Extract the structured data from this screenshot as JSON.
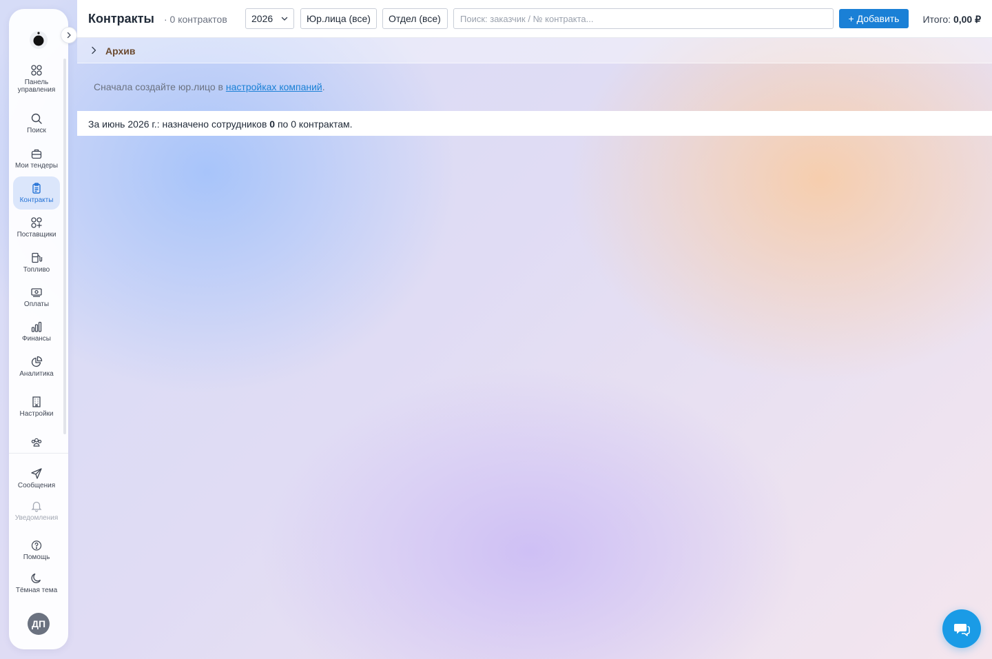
{
  "sidebar": {
    "items": [
      {
        "label": "Панель управления",
        "icon": "dashboard-grid-icon"
      },
      {
        "label": "Поиск",
        "icon": "search-icon"
      },
      {
        "label": "Мои тендеры",
        "icon": "briefcase-icon"
      },
      {
        "label": "Контракты",
        "icon": "contracts-clipboard-icon",
        "active": true
      },
      {
        "label": "Поставщики",
        "icon": "suppliers-grid-icon"
      },
      {
        "label": "Топливо",
        "icon": "fuel-pump-icon"
      },
      {
        "label": "Оплаты",
        "icon": "payment-banknote-icon"
      },
      {
        "label": "Финансы",
        "icon": "bar-chart-icon"
      },
      {
        "label": "Аналитика",
        "icon": "pie-chart-icon"
      },
      {
        "label": "Настройки",
        "icon": "building-icon"
      }
    ],
    "bottom": [
      {
        "label": "Сообщения",
        "icon": "paper-plane-icon"
      },
      {
        "label": "Уведомления",
        "icon": "bell-icon"
      },
      {
        "label": "Помощь",
        "icon": "help-circle-icon"
      },
      {
        "label": "Тёмная тема",
        "icon": "moon-icon"
      }
    ],
    "avatar": "ДП"
  },
  "header": {
    "title": "Контракты",
    "count": "· 0 контрактов",
    "year": "2026",
    "entity_filter": "Юр.лица (все)",
    "department_filter": "Отдел (все)",
    "search_placeholder": "Поиск: заказчик / № контракта...",
    "add_button": "+ Добавить",
    "total_label": "Итого:",
    "total_value": "0,00 ₽"
  },
  "archive": {
    "label": "Архив"
  },
  "notice": {
    "before": "Сначала создайте юр.лицо в ",
    "link": "настройках компаний",
    "after": "."
  },
  "summary": {
    "before": "За июнь 2026 г.: назначено сотрудников ",
    "employees": "0",
    "middle": " по ",
    "contracts": "0",
    "after": " контрактам."
  },
  "colors": {
    "accent": "#1a80d6",
    "active_bg": "#dbe6fb",
    "chat_button": "#1a9be6"
  }
}
